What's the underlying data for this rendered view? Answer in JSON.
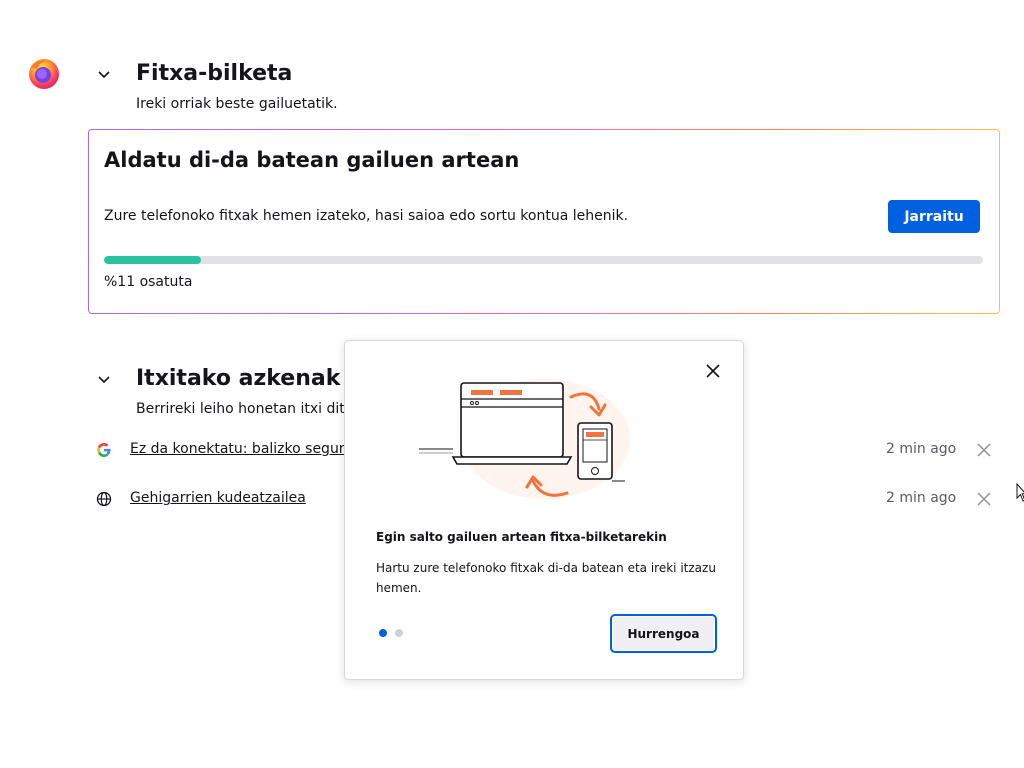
{
  "tab_pickup": {
    "title": "Fitxa-bilketa",
    "subtitle": "Ireki orriak beste gailuetatik.",
    "card": {
      "title": "Aldatu di-da batean gailuen artean",
      "description": "Zure telefonoko fitxak hemen izateko, hasi saioa edo sortu kontua lehenik.",
      "button_label": "Jarraitu",
      "progress_percent": 11,
      "progress_label": "%11 osatuta"
    }
  },
  "recently_closed": {
    "title": "Itxitako azkenak",
    "subtitle": "Berrireki leiho honetan itxi dituzu",
    "items": [
      {
        "label": "Ez da konektatu: balizko segurtas",
        "time": "2 min ago",
        "icon": "google-icon"
      },
      {
        "label": "Gehigarrien kudeatzailea",
        "time": "2 min ago",
        "icon": "globe-icon"
      }
    ]
  },
  "popup": {
    "title": "Egin salto gailuen artean fitxa-bilketarekin",
    "text": "Hartu zure telefonoko fitxak di-da batean eta ireki itzazu hemen.",
    "next_label": "Hurrengoa",
    "step": 1,
    "total_steps": 2
  },
  "colors": {
    "accent": "#0061e0",
    "progress": "#2ac3a2",
    "illustration": "#f0743c"
  }
}
